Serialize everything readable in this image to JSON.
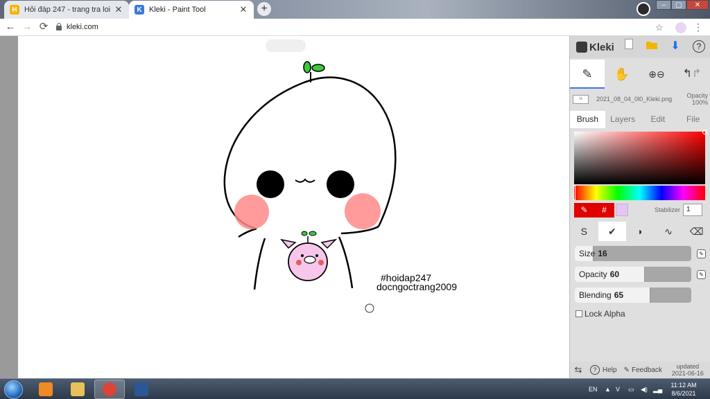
{
  "browser": {
    "tabs": [
      {
        "title": "Hỏi đáp 247 - trang tra loi",
        "favicon_letter": "H",
        "favicon_color": "#f4b400",
        "active": false
      },
      {
        "title": "Kleki - Paint Tool",
        "favicon_letter": "K",
        "favicon_color": "#3a7ad8",
        "active": true
      }
    ],
    "tab_close_glyph": "✕",
    "new_tab_glyph": "+",
    "url": "kleki.com",
    "nav": {
      "back": "←",
      "forward": "→",
      "reload": "⟳"
    },
    "star_glyph": "☆",
    "menu_glyph": "⋮",
    "window_controls": {
      "minimize": "–",
      "maximize": "▢",
      "close": "✕"
    }
  },
  "canvas": {
    "zoom_indicator": "",
    "text_line_1": "#hoidap247",
    "text_line_2": "docngoctrang2009",
    "stroke_color": "#000000",
    "blush_color": "#ff8a8a",
    "leaf_color": "#3cc93c",
    "pig_color": "#f7c6ea"
  },
  "kleki": {
    "brand": "Kleki",
    "header_icons": {
      "new": "new-image-icon",
      "open": "open-folder-icon",
      "download": "download-icon",
      "help": "help-icon"
    },
    "header_glyphs": {
      "help": "?",
      "download": "⬇"
    },
    "tools": {
      "brush_icon": "brush-icon",
      "hand_icon": "hand-icon",
      "zoom_in_icon": "zoom-in-icon",
      "zoom_out_icon": "zoom-out-icon",
      "undo_icon": "undo-icon",
      "redo_icon": "redo-icon"
    },
    "tool_glyphs": {
      "brush": "✎",
      "hand": "✋",
      "zoom_in": "⊕",
      "zoom_out": "⊖",
      "undo": "↰",
      "redo": "↱"
    },
    "file": {
      "thumb_label": "⅓",
      "name": "2021_08_04_0l0_Kleki.png",
      "opacity_label": "Opacity",
      "opacity_value": "100%"
    },
    "tabs": [
      "Brush",
      "Layers",
      "Edit",
      "File"
    ],
    "active_tab": "Brush",
    "color": {
      "primary": "#e00000",
      "secondary": "#e6c4f5",
      "eyedropper_glyph": "✎",
      "hex_glyph": "#"
    },
    "stabilizer": {
      "label": "Stabilizer",
      "value": "1"
    },
    "brush_types": {
      "glyphs": [
        "S",
        "✔",
        "◗",
        "∿",
        "⌫"
      ],
      "active_index": 1
    },
    "sliders": [
      {
        "label": "Size",
        "value": "16",
        "fraction": 0.16
      },
      {
        "label": "Opacity",
        "value": "60",
        "fraction": 0.6
      },
      {
        "label": "Blending",
        "value": "65",
        "fraction": 0.65
      }
    ],
    "lock_alpha": "Lock Alpha",
    "footer": {
      "swap_glyph": "⇆",
      "help": "Help",
      "feedback": "Feedback",
      "updated_label": "updated",
      "updated_date": "2021-06-16"
    }
  },
  "taskbar": {
    "language": "EN",
    "time": "11:12 AM",
    "date": "8/6/2021",
    "apps": [
      {
        "name": "media-player-icon",
        "color": "#f08a24"
      },
      {
        "name": "file-explorer-icon",
        "color": "#e8c15a"
      },
      {
        "name": "chrome-icon",
        "color": "#db4437"
      },
      {
        "name": "word-icon",
        "color": "#2b5797"
      }
    ]
  }
}
